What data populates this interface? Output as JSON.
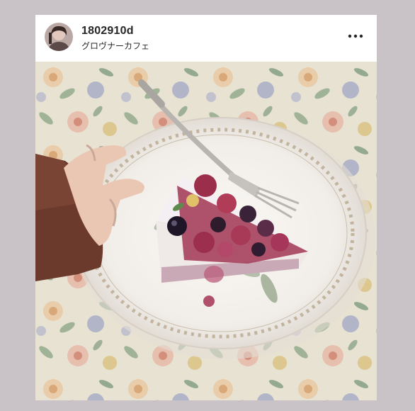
{
  "post": {
    "username": "1802910d",
    "location": "グロヴナーカフェ",
    "menu_icon": "more-horizontal-icon"
  },
  "photo": {
    "subject": "berry-cheesecake-on-plate"
  },
  "colors": {
    "page_background": "#c9c3c8",
    "card_background": "#ffffff",
    "text_primary": "#262626"
  }
}
